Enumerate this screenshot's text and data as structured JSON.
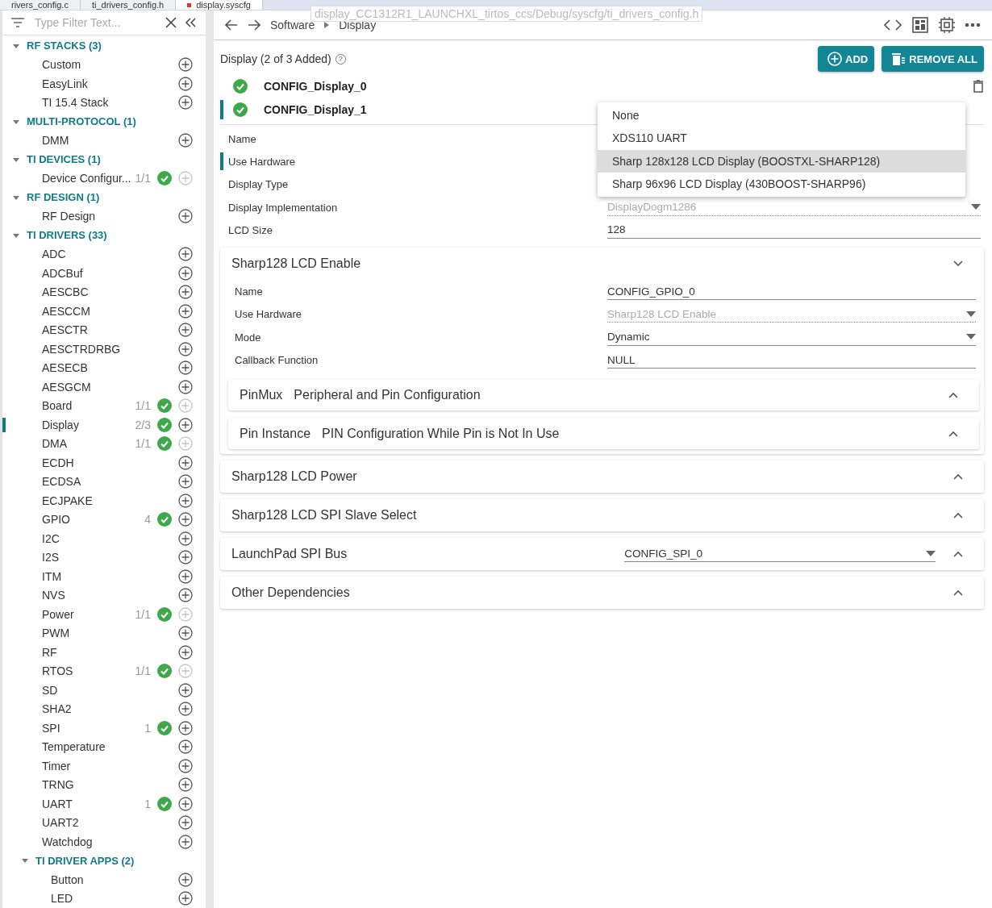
{
  "editor_tabs": [
    {
      "label": "rivers_config.c",
      "modified": false,
      "selected": false
    },
    {
      "label": "ti_drivers_config.h",
      "modified": false,
      "selected": false
    },
    {
      "label": "display.syscfg",
      "modified": true,
      "selected": true
    }
  ],
  "tooltip": "display_CC1312R1_LAUNCHXL_tirtos_ccs/Debug/syscfg/ti_drivers_config.h",
  "sidebar": {
    "filter_placeholder": "Type Filter Text...",
    "items": [
      {
        "kind": "group",
        "label": "RF STACKS (3)",
        "expanded": true,
        "children": [
          {
            "kind": "module",
            "label": "Custom",
            "selected": false,
            "add_disabled": false
          },
          {
            "kind": "module",
            "label": "EasyLink",
            "selected": false,
            "add_disabled": false
          },
          {
            "kind": "module",
            "label": "TI 15.4 Stack",
            "selected": false,
            "add_disabled": false
          }
        ]
      },
      {
        "kind": "group",
        "label": "MULTI-PROTOCOL (1)",
        "expanded": true,
        "children": [
          {
            "kind": "module",
            "label": "DMM",
            "selected": false,
            "add_disabled": false
          }
        ]
      },
      {
        "kind": "group",
        "label": "TI DEVICES (1)",
        "expanded": true,
        "children": [
          {
            "kind": "module",
            "label": "Device Configur...",
            "count": "1/1",
            "added": true,
            "selected": false,
            "add_disabled": true
          }
        ]
      },
      {
        "kind": "group",
        "label": "RF DESIGN (1)",
        "expanded": true,
        "children": [
          {
            "kind": "module",
            "label": "RF Design",
            "selected": false,
            "add_disabled": false
          }
        ]
      },
      {
        "kind": "group",
        "label": "TI DRIVERS (33)",
        "expanded": true,
        "children": [
          {
            "kind": "module",
            "label": "ADC",
            "selected": false,
            "add_disabled": false
          },
          {
            "kind": "module",
            "label": "ADCBuf",
            "selected": false,
            "add_disabled": false
          },
          {
            "kind": "module",
            "label": "AESCBC",
            "selected": false,
            "add_disabled": false
          },
          {
            "kind": "module",
            "label": "AESCCM",
            "selected": false,
            "add_disabled": false
          },
          {
            "kind": "module",
            "label": "AESCTR",
            "selected": false,
            "add_disabled": false
          },
          {
            "kind": "module",
            "label": "AESCTRDRBG",
            "selected": false,
            "add_disabled": false
          },
          {
            "kind": "module",
            "label": "AESECB",
            "selected": false,
            "add_disabled": false
          },
          {
            "kind": "module",
            "label": "AESGCM",
            "selected": false,
            "add_disabled": false
          },
          {
            "kind": "module",
            "label": "Board",
            "count": "1/1",
            "added": true,
            "selected": false,
            "add_disabled": true
          },
          {
            "kind": "module",
            "label": "Display",
            "count": "2/3",
            "added": true,
            "selected": true,
            "add_disabled": false
          },
          {
            "kind": "module",
            "label": "DMA",
            "count": "1/1",
            "added": true,
            "selected": false,
            "add_disabled": true
          },
          {
            "kind": "module",
            "label": "ECDH",
            "selected": false,
            "add_disabled": false
          },
          {
            "kind": "module",
            "label": "ECDSA",
            "selected": false,
            "add_disabled": false
          },
          {
            "kind": "module",
            "label": "ECJPAKE",
            "selected": false,
            "add_disabled": false
          },
          {
            "kind": "module",
            "label": "GPIO",
            "count": "4",
            "added": true,
            "selected": false,
            "add_disabled": false
          },
          {
            "kind": "module",
            "label": "I2C",
            "selected": false,
            "add_disabled": false
          },
          {
            "kind": "module",
            "label": "I2S",
            "selected": false,
            "add_disabled": false
          },
          {
            "kind": "module",
            "label": "ITM",
            "selected": false,
            "add_disabled": false
          },
          {
            "kind": "module",
            "label": "NVS",
            "selected": false,
            "add_disabled": false
          },
          {
            "kind": "module",
            "label": "Power",
            "count": "1/1",
            "added": true,
            "selected": false,
            "add_disabled": true
          },
          {
            "kind": "module",
            "label": "PWM",
            "selected": false,
            "add_disabled": false
          },
          {
            "kind": "module",
            "label": "RF",
            "selected": false,
            "add_disabled": false
          },
          {
            "kind": "module",
            "label": "RTOS",
            "count": "1/1",
            "added": true,
            "selected": false,
            "add_disabled": true
          },
          {
            "kind": "module",
            "label": "SD",
            "selected": false,
            "add_disabled": false
          },
          {
            "kind": "module",
            "label": "SHA2",
            "selected": false,
            "add_disabled": false
          },
          {
            "kind": "module",
            "label": "SPI",
            "count": "1",
            "added": true,
            "selected": false,
            "add_disabled": false
          },
          {
            "kind": "module",
            "label": "Temperature",
            "selected": false,
            "add_disabled": false
          },
          {
            "kind": "module",
            "label": "Timer",
            "selected": false,
            "add_disabled": false
          },
          {
            "kind": "module",
            "label": "TRNG",
            "selected": false,
            "add_disabled": false
          },
          {
            "kind": "module",
            "label": "UART",
            "count": "1",
            "added": true,
            "selected": false,
            "add_disabled": false
          },
          {
            "kind": "module",
            "label": "UART2",
            "selected": false,
            "add_disabled": false
          },
          {
            "kind": "module",
            "label": "Watchdog",
            "selected": false,
            "add_disabled": false
          },
          {
            "kind": "group",
            "label": "TI DRIVER APPS (2)",
            "expanded": true,
            "children": [
              {
                "kind": "module",
                "label": "Button",
                "selected": false,
                "add_disabled": false
              },
              {
                "kind": "module",
                "label": "LED",
                "selected": false,
                "add_disabled": false
              }
            ]
          }
        ]
      }
    ]
  },
  "breadcrumb": [
    "Software",
    "Display"
  ],
  "module": {
    "title": "Display (2 of 3 Added)",
    "help": "?",
    "add_button": "ADD",
    "remove_all_button": "REMOVE ALL",
    "instances": [
      {
        "name": "CONFIG_Display_0",
        "selected": false
      },
      {
        "name": "CONFIG_Display_1",
        "selected": true
      }
    ],
    "fields": [
      {
        "label": "Name",
        "selected": false
      },
      {
        "label": "Use Hardware",
        "selected": true
      },
      {
        "label": "Display Type",
        "selected": false
      },
      {
        "label": "Display Implementation",
        "kind": "select",
        "value": "DisplayDogm1286",
        "disabled": true,
        "selected": false
      },
      {
        "label": "LCD Size",
        "kind": "text",
        "value": "128",
        "disabled": false,
        "selected": false
      }
    ],
    "dropdown": [
      {
        "label": "None",
        "selected": false
      },
      {
        "label": "XDS110 UART",
        "selected": false
      },
      {
        "label": "Sharp 128x128 LCD Display (BOOSTXL-SHARP128)",
        "selected": true
      },
      {
        "label": "Sharp 96x96 LCD Display (430BOOST-SHARP96)",
        "selected": false
      }
    ],
    "sections": [
      {
        "title": "Sharp128 LCD Enable",
        "expanded": true,
        "fields": [
          {
            "label": "Name",
            "kind": "text",
            "value": "CONFIG_GPIO_0",
            "disabled": false
          },
          {
            "label": "Use Hardware",
            "kind": "select",
            "value": "Sharp128 LCD Enable",
            "disabled": true
          },
          {
            "label": "Mode",
            "kind": "select",
            "value": "Dynamic",
            "disabled": false
          },
          {
            "label": "Callback Function",
            "kind": "text",
            "value": "NULL",
            "disabled": false
          }
        ],
        "subsections": [
          {
            "title": "PinMux",
            "subtitle": "Peripheral and Pin Configuration",
            "expanded": false
          },
          {
            "title": "Pin Instance",
            "subtitle": "PIN Configuration While Pin is Not In Use",
            "expanded": false
          }
        ]
      },
      {
        "title": "Sharp128 LCD Power",
        "expanded": false
      },
      {
        "title": "Sharp128 LCD SPI Slave Select",
        "expanded": false
      },
      {
        "title": "LaunchPad SPI Bus",
        "expanded": false,
        "value": "CONFIG_SPI_0"
      },
      {
        "title": "Other Dependencies",
        "expanded": false
      }
    ]
  }
}
